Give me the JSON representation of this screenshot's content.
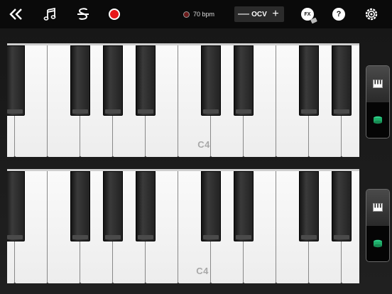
{
  "toolbar": {
    "back_icon": "double-chevron-left-icon",
    "music_icon": "music-note-icon",
    "switch_icon": "s-arrows-icon",
    "record_icon": "record-icon",
    "tempo_value": "70 bpm",
    "octave_minus": "—",
    "octave_label": "OCV",
    "octave_plus": "+",
    "fx_label": "FX",
    "help_label": "?",
    "settings_icon": "gear-icon"
  },
  "keyboards": [
    {
      "note_label": "C4",
      "mode_icons": [
        "piano-icon",
        "drum-icon"
      ]
    },
    {
      "note_label": "C4",
      "mode_icons": [
        "piano-icon",
        "drum-icon"
      ]
    }
  ],
  "colors": {
    "record": "#e8171a",
    "drum_accent": "#1fae6a",
    "toolbar_bg": "#0a0a0a"
  }
}
